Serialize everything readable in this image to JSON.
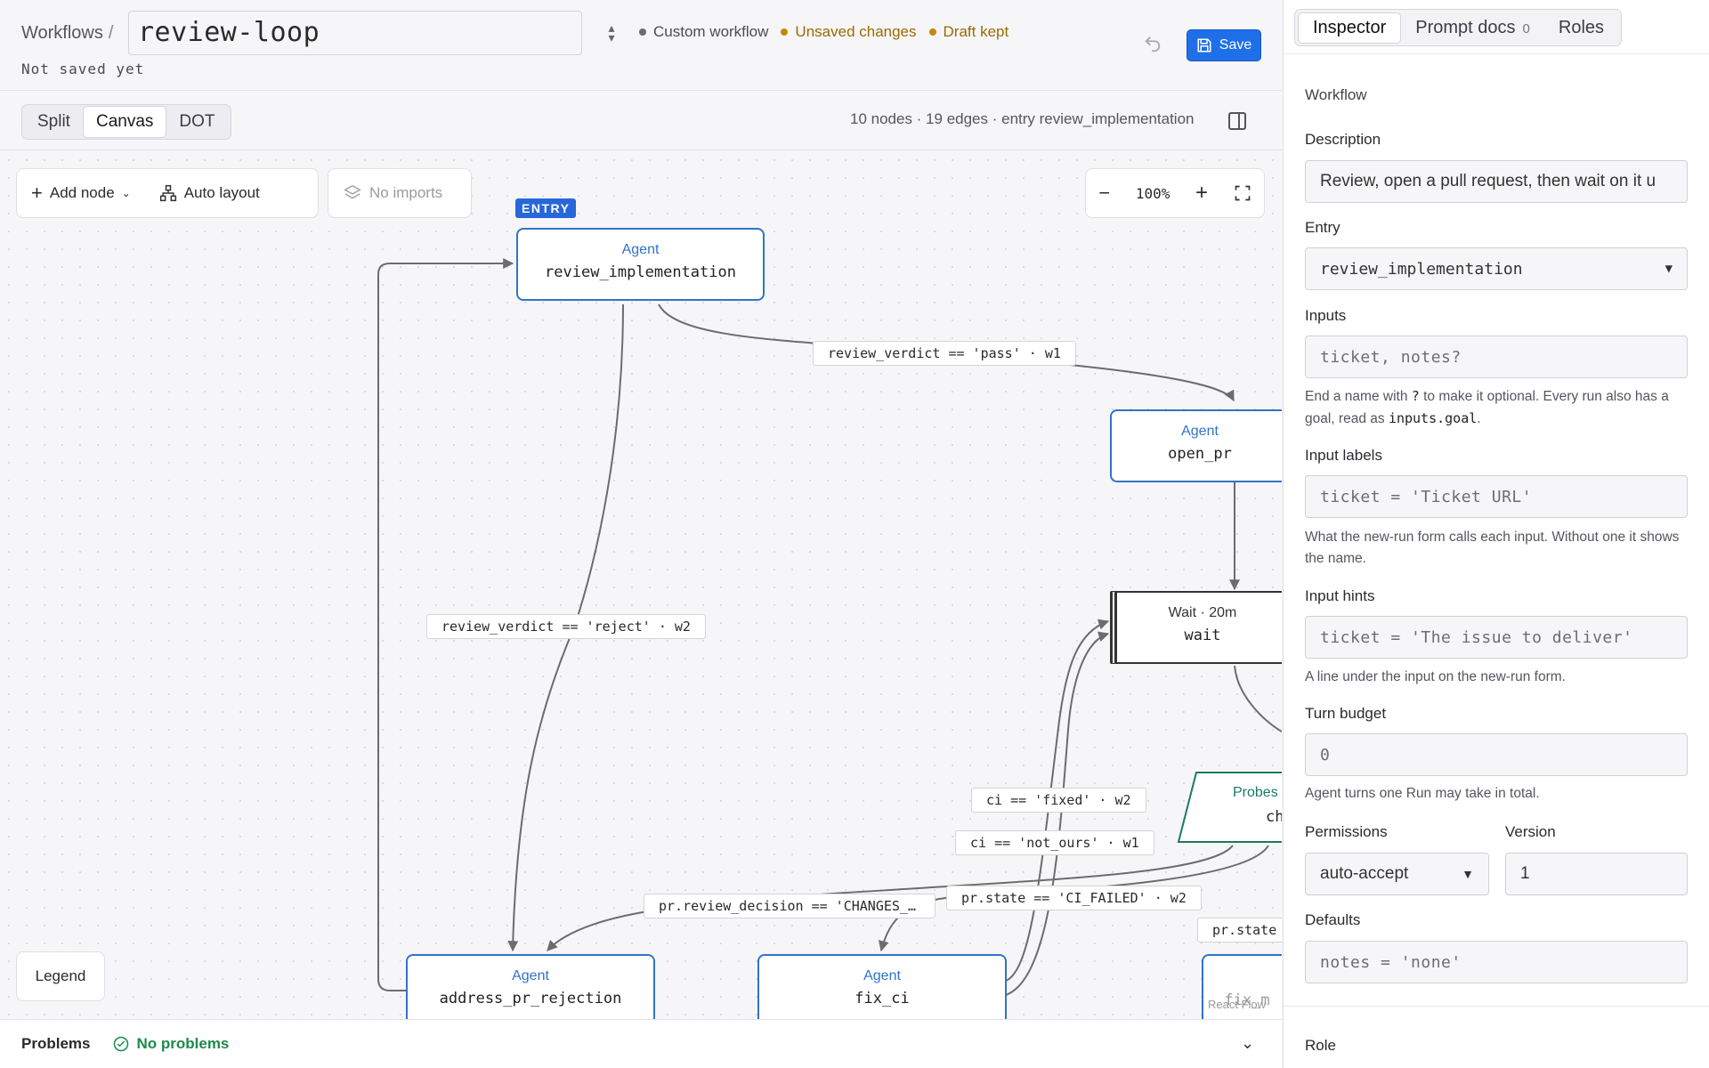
{
  "header": {
    "breadcrumb": "Workflows",
    "breadcrumb_sep": "/",
    "workflow_name": "review-loop",
    "status_items": [
      {
        "label": "Custom workflow",
        "color": "#6b6b73"
      },
      {
        "label": "Unsaved changes",
        "color": "#c38a00"
      },
      {
        "label": "Draft kept",
        "color": "#c38a00"
      }
    ],
    "save_state": "Not saved yet",
    "save_label": "Save"
  },
  "toolbar": {
    "view_modes": [
      "Split",
      "Canvas",
      "DOT"
    ],
    "active_view": "Canvas",
    "graph_summary": "10 nodes · 19 edges · entry review_implementation"
  },
  "canvas_tools": {
    "add_node": "Add node",
    "auto_layout": "Auto layout",
    "no_imports": "No imports",
    "zoom": "100%",
    "legend": "Legend",
    "attribution": "React Flow"
  },
  "entry_badge": "ENTRY",
  "nodes": [
    {
      "id": "review_implementation",
      "kind": "Agent",
      "name": "review_implementation"
    },
    {
      "id": "open_pr",
      "kind": "Agent",
      "name": "open_pr"
    },
    {
      "id": "wait",
      "kind": "Wait · 20m",
      "name": "wait"
    },
    {
      "id": "probes",
      "kind": "Probes",
      "name": "ch"
    },
    {
      "id": "address_pr_rejection",
      "kind": "Agent",
      "name": "address_pr_rejection"
    },
    {
      "id": "fix_ci",
      "kind": "Agent",
      "name": "fix_ci"
    },
    {
      "id": "fix_m",
      "kind": "",
      "name": "fix_m"
    }
  ],
  "edge_labels": [
    "review_verdict == 'pass' · w1",
    "review_verdict == 'reject' · w2",
    "ci == 'fixed' · w2",
    "ci == 'not_ours' · w1",
    "pr.state == 'CI_FAILED' · w2",
    "pr.review_decision == 'CHANGES_…",
    "pr.state"
  ],
  "problems": {
    "label": "Problems",
    "status": "No problems",
    "status_color": "#1d8a4d"
  },
  "sidebar": {
    "tabs": [
      "Inspector",
      "Prompt docs",
      "Roles"
    ],
    "prompt_docs_count": "0",
    "active_tab": "Inspector",
    "section_title": "Workflow",
    "description_label": "Description",
    "description_value": "Review, open a pull request, then wait on it u",
    "entry_label": "Entry",
    "entry_value": "review_implementation",
    "inputs_label": "Inputs",
    "inputs_placeholder": "ticket, notes?",
    "inputs_hint_pre": "End a name with",
    "inputs_hint_code1": "?",
    "inputs_hint_mid": "to make it optional. Every run also has a goal, read as",
    "inputs_hint_code2": "inputs.goal",
    "inputs_hint_post": ".",
    "input_labels_label": "Input labels",
    "input_labels_placeholder": "ticket = 'Ticket URL'",
    "input_labels_hint": "What the new-run form calls each input. Without one it shows the name.",
    "input_hints_label": "Input hints",
    "input_hints_placeholder": "ticket = 'The issue to deliver'",
    "input_hints_hint": "A line under the input on the new-run form.",
    "turn_budget_label": "Turn budget",
    "turn_budget_placeholder": "0",
    "turn_budget_hint": "Agent turns one Run may take in total.",
    "permissions_label": "Permissions",
    "permissions_value": "auto-accept",
    "version_label": "Version",
    "version_value": "1",
    "defaults_label": "Defaults",
    "defaults_placeholder": "notes = 'none'",
    "role_label": "Role"
  }
}
